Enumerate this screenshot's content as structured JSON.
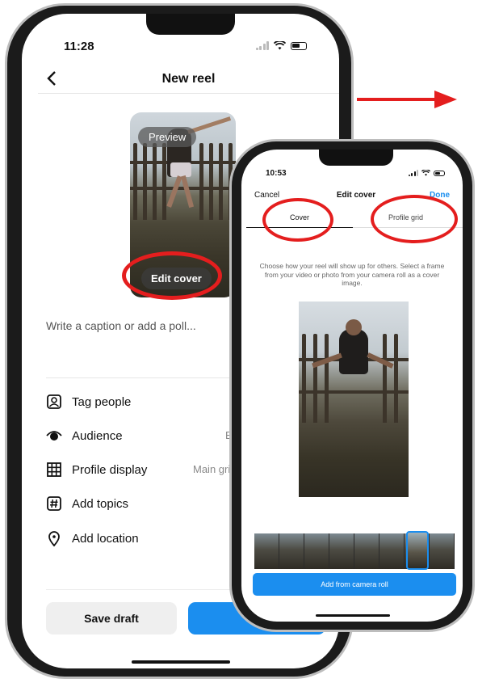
{
  "colors": {
    "accent": "#1b8eef",
    "annotation": "#e41e1e"
  },
  "screen1": {
    "time": "11:28",
    "title": "New reel",
    "back_icon": "chevron-left-icon",
    "preview_label": "Preview",
    "edit_cover_label": "Edit cover",
    "caption_placeholder": "Write a caption or add a poll...",
    "rows": [
      {
        "icon": "tag-people-icon",
        "label": "Tag people",
        "value": ""
      },
      {
        "icon": "audience-eye-icon",
        "label": "Audience",
        "value": "Ev"
      },
      {
        "icon": "grid-icon",
        "label": "Profile display",
        "value": "Main grid"
      },
      {
        "icon": "hashtag-icon",
        "label": "Add topics",
        "value": ""
      },
      {
        "icon": "location-pin-icon",
        "label": "Add location",
        "value": ""
      }
    ],
    "save_draft_label": "Save draft"
  },
  "screen2": {
    "time": "10:53",
    "cancel_label": "Cancel",
    "title": "Edit cover",
    "done_label": "Done",
    "tabs": [
      "Cover",
      "Profile grid"
    ],
    "description": "Choose how your reel will show up for others. Select a frame from your video or photo from your camera roll as a cover image.",
    "add_button_label": "Add from camera roll"
  }
}
